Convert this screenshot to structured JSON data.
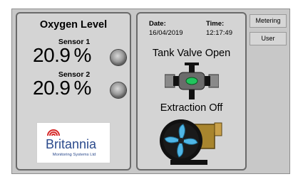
{
  "oxygen_panel": {
    "title": "Oxygen Level",
    "sensors": [
      {
        "label": "Sensor 1",
        "value": "20.9",
        "unit": "%"
      },
      {
        "label": "Sensor 2",
        "value": "20.9",
        "unit": "%"
      }
    ]
  },
  "logo": {
    "name": "Britannia",
    "tagline": "Monitoring Systems Ltd"
  },
  "status_panel": {
    "date_label": "Date:",
    "date_value": "16/04/2019",
    "time_label": "Time:",
    "time_value": "12:17:49",
    "valve_status": "Tank Valve Open",
    "extraction_status": "Extraction Off"
  },
  "menu": {
    "buttons": [
      {
        "label": "Metering"
      },
      {
        "label": "User"
      }
    ]
  },
  "colors": {
    "valve_indicator": "#22c55e",
    "fan_blade": "#4fb6e6",
    "pump_body": "#a8852e"
  }
}
